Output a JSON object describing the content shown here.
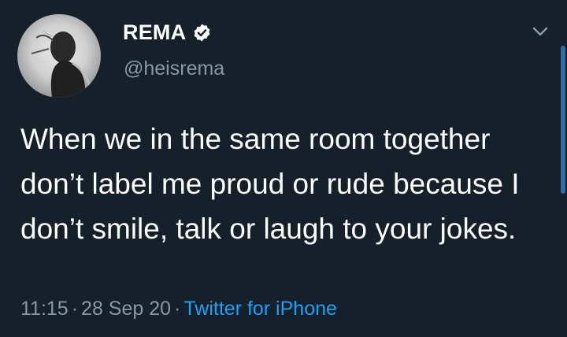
{
  "author": {
    "display_name": "REMA",
    "handle": "@heisrema",
    "verified": true,
    "avatar_icon": "profile-photo-grayscale"
  },
  "tweet": {
    "text": "When we in the same room together don’t label me proud or rude because I don’t smile, talk or laugh to your jokes.",
    "time": "11:15",
    "date": "28 Sep 20",
    "separator": "·",
    "source": "Twitter for iPhone"
  },
  "icons": {
    "verified": "verified-badge-icon",
    "menu": "chevron-down-icon"
  },
  "colors": {
    "background": "#15202b",
    "primary_text": "#ffffff",
    "secondary_text": "#8899a6",
    "link": "#1da1f2"
  }
}
